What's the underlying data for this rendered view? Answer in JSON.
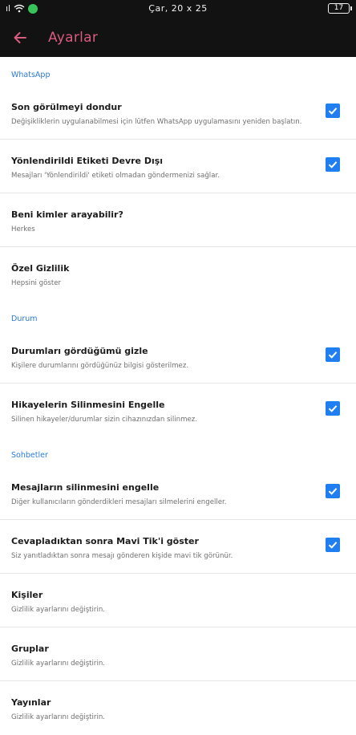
{
  "status_bar": {
    "signal_text": "ıl",
    "time": "Çar, 20 x 25",
    "battery": "17"
  },
  "app_bar": {
    "title": "Ayarlar"
  },
  "sections": [
    {
      "header": "WhatsApp",
      "rows": [
        {
          "title": "Son görülmeyi dondur",
          "subtitle": "Değişikliklerin uygulanabilmesi için lütfen WhatsApp uygulamasını yeniden başlatın.",
          "checked": true
        },
        {
          "title": "Yönlendirildi Etiketi Devre Dışı",
          "subtitle": "Mesajları 'Yönlendirildi' etiketi olmadan göndermenizi sağlar.",
          "checked": true
        },
        {
          "title": "Beni kimler arayabilir?",
          "subtitle": "Herkes"
        },
        {
          "title": "Özel Gizlilik",
          "subtitle": "Hepsini göster"
        }
      ]
    },
    {
      "header": "Durum",
      "rows": [
        {
          "title": "Durumları gördüğümü gizle",
          "subtitle": "Kişilere durumlarını gördüğünüz bilgisi gösterilmez.",
          "checked": true
        },
        {
          "title": "Hikayelerin Silinmesini Engelle",
          "subtitle": "Silinen hikayeler/durumlar sizin cihazınızdan silinmez.",
          "checked": true
        }
      ]
    },
    {
      "header": "Sohbetler",
      "rows": [
        {
          "title": "Mesajların silinmesini engelle",
          "subtitle": "Diğer kullanıcıların gönderdikleri mesajları silmelerini engeller.",
          "checked": true
        },
        {
          "title": "Cevapladıktan sonra Mavi Tik'i göster",
          "subtitle": "Siz yanıtladıktan sonra mesajı gönderen kişide mavi tik görünür.",
          "checked": true
        },
        {
          "title": "Kişiler",
          "subtitle": "Gizlilik ayarlarını değiştirin."
        },
        {
          "title": "Gruplar",
          "subtitle": "Gizlilik ayarlarını değiştirin."
        },
        {
          "title": "Yayınlar",
          "subtitle": "Gizlilik ayarlarını değiştirin."
        }
      ]
    }
  ],
  "colors": {
    "accent": "#d95b80",
    "section_header": "#2a7ad8",
    "checkbox": "#1f7ff0",
    "bar_bg": "#121212"
  },
  "icons": {
    "back": "arrow-left-icon",
    "wifi": "wifi-icon",
    "checkbox": "checkmark-icon"
  }
}
